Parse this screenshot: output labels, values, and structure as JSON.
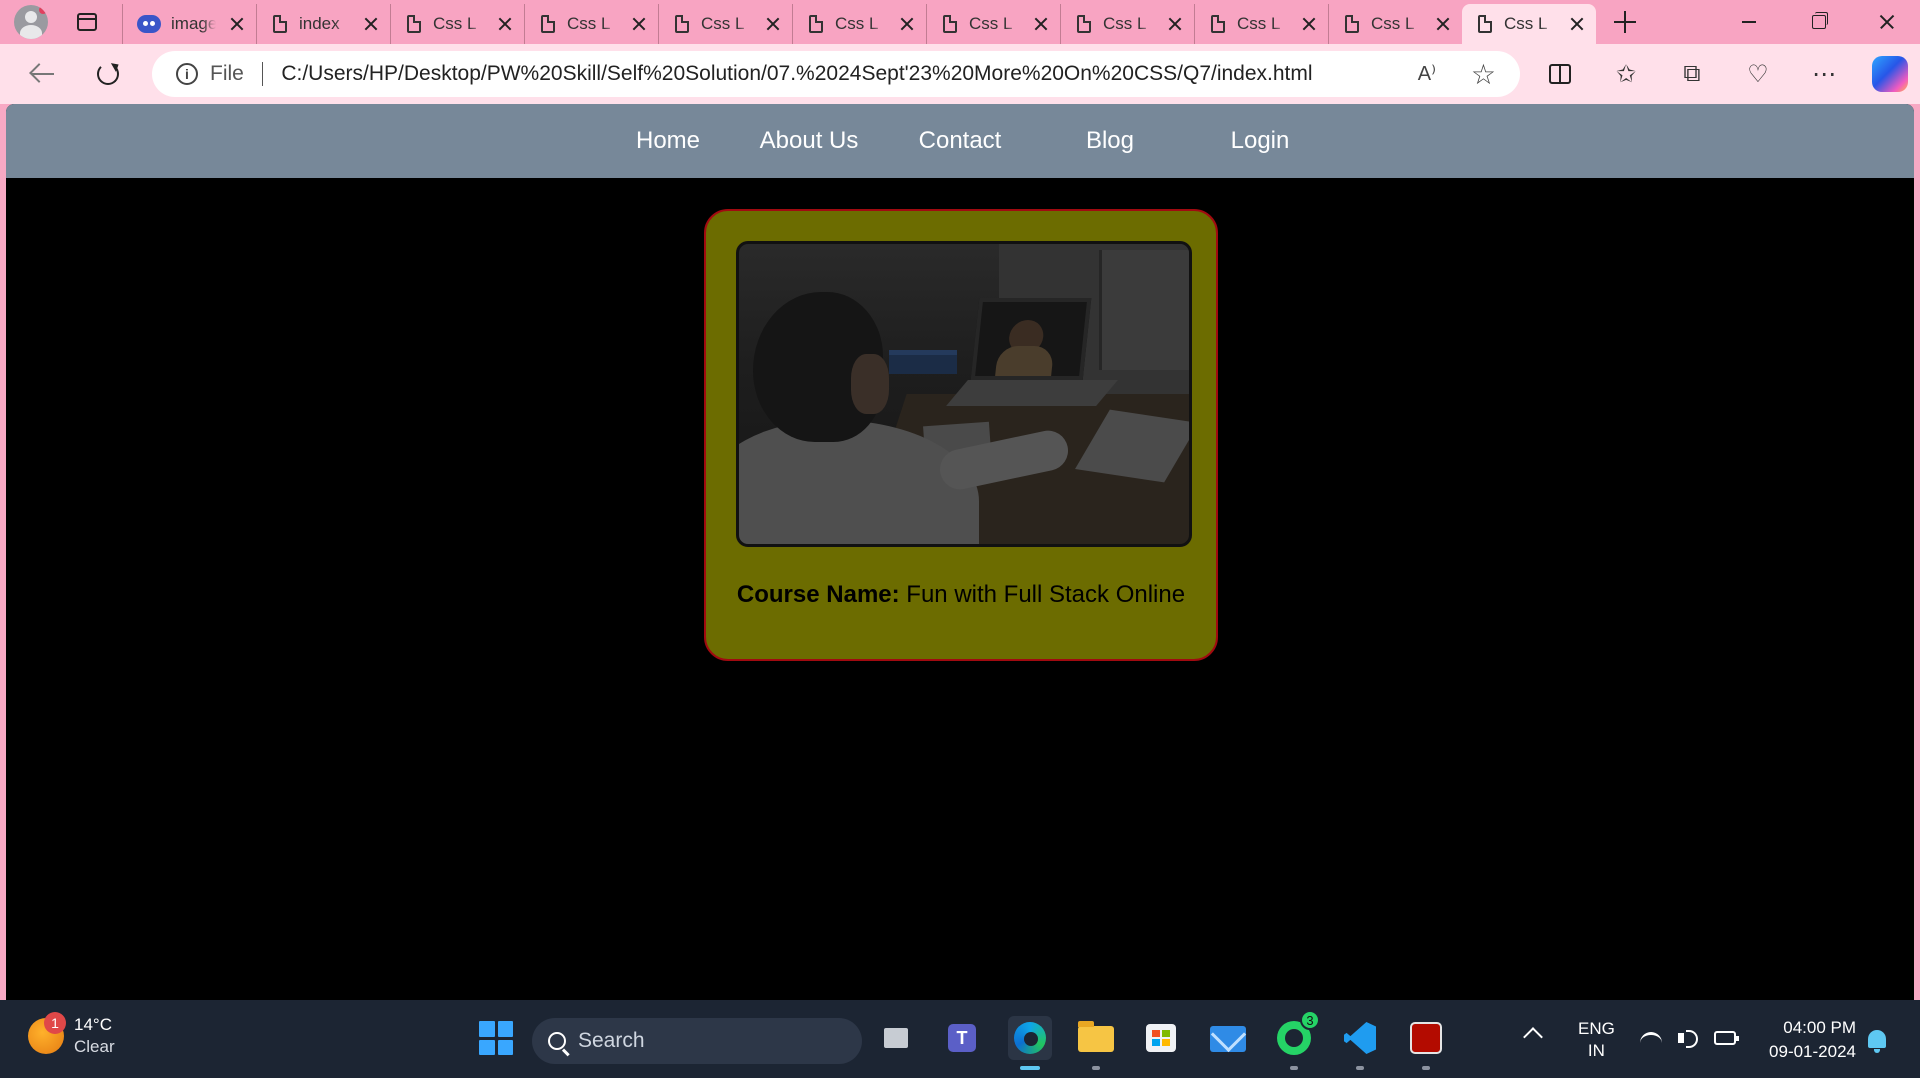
{
  "browser": {
    "tabs": [
      {
        "title": "image"
      },
      {
        "title": "index"
      },
      {
        "title": "Css L"
      },
      {
        "title": "Css L"
      },
      {
        "title": "Css L"
      },
      {
        "title": "Css L"
      },
      {
        "title": "Css L"
      },
      {
        "title": "Css L"
      },
      {
        "title": "Css L"
      },
      {
        "title": "Css L"
      },
      {
        "title": "Css L",
        "active": true
      }
    ],
    "address": {
      "scheme": "File",
      "url": "C:/Users/HP/Desktop/PW%20Skill/Self%20Solution/07.%2024Sept'23%20More%20On%20CSS/Q7/index.html",
      "read_aloud": "A⁾"
    }
  },
  "page": {
    "nav": {
      "home": "Home",
      "about": "About Us",
      "contact": "Contact",
      "blog": "Blog",
      "login": "Login"
    },
    "card": {
      "label": "Course Name:",
      "value": " Fun with Full Stack Online",
      "accent": "#6c6c00",
      "border": "#a10a10"
    },
    "colors": {
      "navbar": "#778899",
      "background": "#000000"
    }
  },
  "taskbar": {
    "weather": {
      "temp": "14°C",
      "condition": "Clear",
      "badge": "1"
    },
    "search_placeholder": "Search",
    "whatsapp_badge": "3",
    "language": {
      "line1": "ENG",
      "line2": "IN"
    },
    "clock": {
      "time": "04:00 PM",
      "date": "09-01-2024"
    }
  }
}
